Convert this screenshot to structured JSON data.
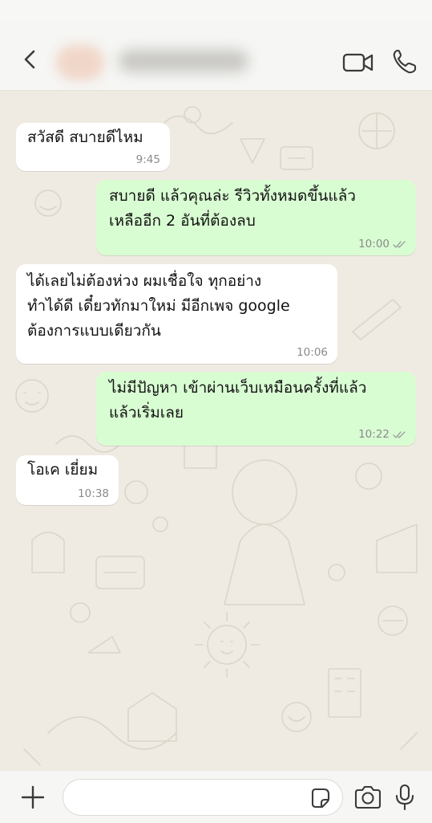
{
  "header": {
    "back_icon": "chevron-left-icon",
    "video_icon": "video-call-icon",
    "phone_icon": "phone-icon",
    "contact_name_blurred": true
  },
  "colors": {
    "incoming_bubble": "#ffffff",
    "outgoing_bubble": "#d9fdd3",
    "chat_background": "#efeae2",
    "timestamp": "#8a8a8a"
  },
  "messages": [
    {
      "direction": "incoming",
      "lines": [
        "สวัสดี สบายดีไหม"
      ],
      "time": "9:45"
    },
    {
      "direction": "outgoing",
      "lines": [
        "สบายดี แล้วคุณล่ะ รีวิวทั้งหมดขึ้นแล้ว",
        "เหลืออีก 2 อันที่ต้องลบ"
      ],
      "time": "10:00",
      "status": "delivered"
    },
    {
      "direction": "incoming",
      "lines": [
        "ได้เลยไม่ต้องห่วง ผมเชื่อใจ ทุกอย่าง",
        "ทำได้ดี เดี๋ยวทักมาใหม่ มีอีกเพจ google",
        "ต้องการแบบเดียวกัน"
      ],
      "time": "10:06"
    },
    {
      "direction": "outgoing",
      "lines": [
        "ไม่มีปัญหา เข้าผ่านเว็บเหมือนครั้งที่แล้ว",
        "แล้วเริ่มเลย"
      ],
      "time": "10:22",
      "status": "delivered"
    },
    {
      "direction": "incoming",
      "lines": [
        "โอเค เยี่ยม"
      ],
      "time": "10:38"
    }
  ],
  "input": {
    "placeholder": "",
    "icons": [
      "plus-icon",
      "sticker-icon",
      "camera-icon",
      "microphone-icon"
    ]
  }
}
